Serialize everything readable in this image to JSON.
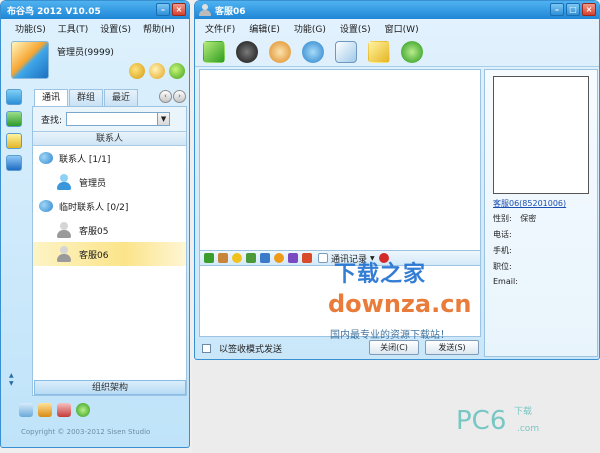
{
  "left_window": {
    "title": "布谷鸟 2012 V10.05",
    "menu": [
      "功能(S)",
      "工具(T)",
      "设置(S)",
      "帮助(H)"
    ],
    "username": "管理员(9999)",
    "tabs": [
      "通讯",
      "群组",
      "最近"
    ],
    "find_label": "查找:",
    "find_value": "",
    "contacts_header": "联系人",
    "groups": [
      {
        "label": "联系人 [1/1]",
        "members": [
          "管理员"
        ]
      },
      {
        "label": "临时联系人 [0/2]",
        "members": [
          "客服05",
          "客服06"
        ]
      }
    ],
    "selected_member": "客服06",
    "org_bar": "组织架构",
    "copyright": "Copyright © 2003-2012 Sisen Studio"
  },
  "right_window": {
    "title": "客服06",
    "menu": [
      "文件(F)",
      "编辑(E)",
      "功能(G)",
      "设置(S)",
      "窗口(W)"
    ],
    "toolbar_icons": [
      "file-transfer-icon",
      "voice-icon",
      "video-icon",
      "remote-desktop-icon",
      "screenshot-icon",
      "check-icon",
      "group-icon"
    ],
    "history_label": "通讯记录",
    "receive_mode_label": "以签收模式发送",
    "close_button": "关闭(C)",
    "send_button": "发送(S)",
    "info": {
      "name_link": "客服06(85201006)",
      "gender_label": "性别:",
      "gender_value": "保密",
      "phone_label": "电话:",
      "mobile_label": "手机:",
      "position_label": "职位:",
      "email_label": "Email:"
    }
  },
  "watermark": {
    "line1": "下载之家",
    "line2": "downza.cn",
    "line3": "国内最专业的资源下载站！",
    "pc6": "PC6",
    "pc6_sub": "下载",
    ".com": ".com"
  },
  "colors": {
    "titlebar": "#1f86d6",
    "window_border": "#3a8fd0",
    "selected_row": "#fbe48a",
    "link": "#1b4fb0"
  }
}
